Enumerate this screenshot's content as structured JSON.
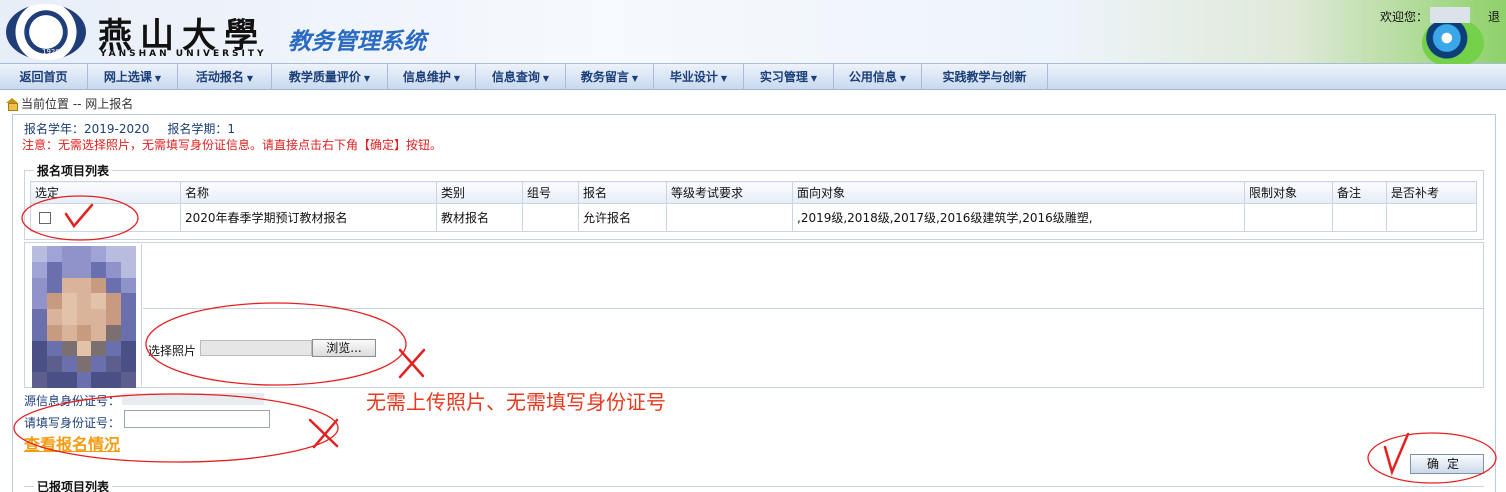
{
  "header": {
    "school_cn": "燕山大學",
    "school_en": "YANSHAN UNIVERSITY",
    "seal_year": "1920",
    "system_title": "教务管理系统",
    "welcome": "欢迎您：",
    "logout": "退"
  },
  "nav": {
    "items": [
      {
        "label": "返回首页",
        "dropdown": false
      },
      {
        "label": "网上选课",
        "dropdown": true
      },
      {
        "label": "活动报名",
        "dropdown": true
      },
      {
        "label": "教学质量评价",
        "dropdown": true
      },
      {
        "label": "信息维护",
        "dropdown": true
      },
      {
        "label": "信息查询",
        "dropdown": true
      },
      {
        "label": "教务留言",
        "dropdown": true
      },
      {
        "label": "毕业设计",
        "dropdown": true
      },
      {
        "label": "实习管理",
        "dropdown": true
      },
      {
        "label": "公用信息",
        "dropdown": true
      },
      {
        "label": "实践教学与创新",
        "dropdown": false
      }
    ]
  },
  "breadcrumb": "当前位置 -- 网上报名",
  "info": {
    "year": "报名学年：2019-2020",
    "term": "报名学期：1",
    "notice": "注意：无需选择照片，无需填写身份证信息。请直接点击右下角【确定】按钮。"
  },
  "project_list": {
    "legend": "报名项目列表",
    "headers": [
      "选定",
      "名称",
      "类别",
      "组号",
      "报名",
      "等级考试要求",
      "面向对象",
      "限制对象",
      "备注",
      "是否补考"
    ],
    "rows": [
      [
        "",
        "2020年春季学期预订教材报名",
        "教材报名",
        "",
        "允许报名",
        "",
        ",2019级,2018级,2017级,2016级建筑学,2016级雕塑,",
        "",
        "",
        ""
      ]
    ]
  },
  "photo": {
    "choose_label": "选择照片",
    "browse_label": "浏览..."
  },
  "identity": {
    "source_label": "源信息身份证号：",
    "fill_label": "请填写身份证号：",
    "input_value": ""
  },
  "check_link": "查看报名情况",
  "annotation": "无需上传照片、无需填写身份证号",
  "confirm_label": "确定",
  "reported_list": {
    "legend": "已报项目列表"
  },
  "colors": {
    "nav_text": "#1b3f78",
    "notice": "#e02020",
    "annotation": "#e53a20",
    "link": "#f39c12"
  }
}
